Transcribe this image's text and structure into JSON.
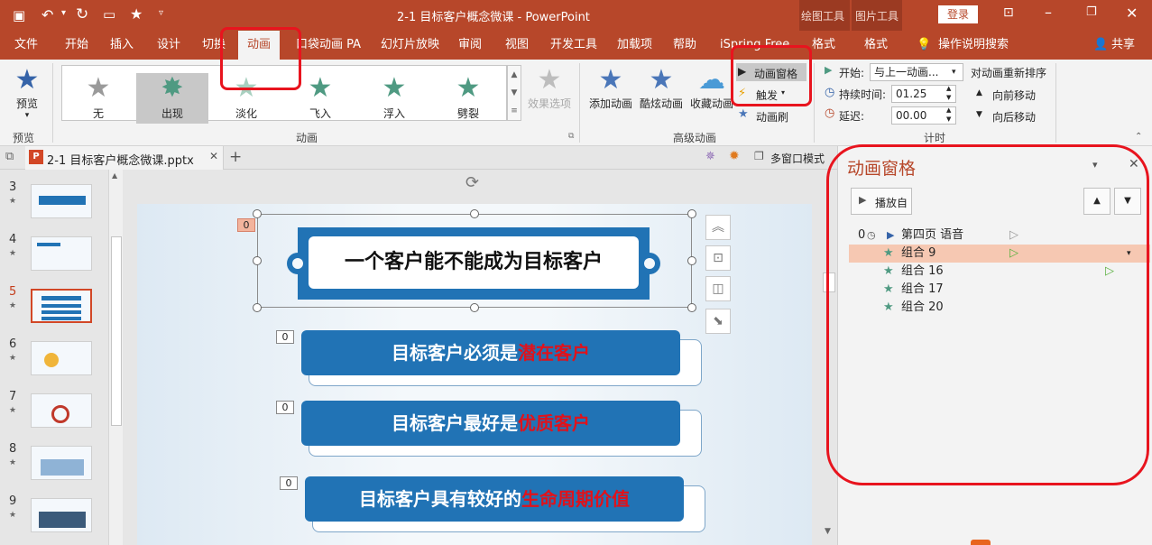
{
  "titlebar": {
    "title": "2-1 目标客户概念微课 - PowerPoint",
    "context_tab_1": "绘图工具",
    "context_tab_2": "图片工具",
    "login": "登录"
  },
  "tabs": [
    "文件",
    "开始",
    "插入",
    "设计",
    "切换",
    "动画",
    "口袋动画 PA",
    "幻灯片放映",
    "审阅",
    "视图",
    "开发工具",
    "加载项",
    "帮助",
    "iSpring Free",
    "格式",
    "格式"
  ],
  "tell_me": "操作说明搜索",
  "share": "共享",
  "ribbon": {
    "preview": "预览",
    "preview_group": "预览",
    "gallery": [
      "无",
      "出现",
      "淡化",
      "飞入",
      "浮入",
      "劈裂"
    ],
    "effect_options": "效果选项",
    "animation_group": "动画",
    "add_animation": "添加动画",
    "cool_animation": "酷炫动画",
    "favorite_animation": "收藏动画",
    "animation_pane": "动画窗格",
    "trigger": "触发",
    "animation_painter": "动画刷",
    "advanced_group": "高级动画",
    "start_label": "开始:",
    "start_value": "与上一动画...",
    "duration_label": "持续时间:",
    "duration_value": "01.25",
    "delay_label": "延迟:",
    "delay_value": "00.00",
    "reorder_title": "对动画重新排序",
    "move_earlier": "向前移动",
    "move_later": "向后移动",
    "timing_group": "计时"
  },
  "doc": {
    "tab_name": "2-1 目标客户概念微课.pptx",
    "multi_window": "多窗口模式"
  },
  "thumbnails": [
    "3",
    "4",
    "5",
    "6",
    "7",
    "8",
    "9"
  ],
  "slide": {
    "title": "一个客户能不能成为目标客户",
    "line1_a": "目标客户必须是",
    "line1_b": "潜在客户",
    "line2_a": "目标客户最好是",
    "line2_b": "优质客户",
    "line3_a": "目标客户具有较好的",
    "line3_b": "生命周期价值",
    "tag": "0"
  },
  "pane": {
    "title": "动画窗格",
    "play_from": "播放自",
    "items": [
      {
        "num": "0",
        "label": "第四页 语音"
      },
      {
        "num": "",
        "label": "组合 9"
      },
      {
        "num": "",
        "label": "组合 16"
      },
      {
        "num": "",
        "label": "组合 17"
      },
      {
        "num": "",
        "label": "组合 20"
      }
    ]
  },
  "colors": {
    "brand": "#b7472a",
    "accent_blue": "#2173b5",
    "highlight_red": "#e0121b",
    "star_green": "#4f9a82"
  }
}
